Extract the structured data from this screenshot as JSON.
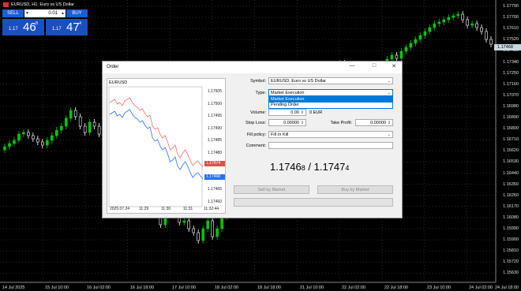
{
  "header": {
    "title": "EURUSD, H1: Euro vs US Dollar",
    "sell_label": "SELL",
    "buy_label": "BUY",
    "volume": "0.01",
    "sell_small": "1.17",
    "sell_big": "46",
    "sell_sup": "8",
    "buy_small": "1.17",
    "buy_big": "47",
    "buy_sup": "4"
  },
  "main_axis": {
    "prices": [
      "1.17790",
      "1.17700",
      "1.17610",
      "1.17520",
      "1.17430",
      "1.17340",
      "1.17250",
      "1.17160",
      "1.17070",
      "1.16980",
      "1.16890",
      "1.16800",
      "1.16710",
      "1.16620",
      "1.16530",
      "1.16440",
      "1.16350",
      "1.16260",
      "1.16170",
      "1.16080",
      "1.15990",
      "1.15900",
      "1.15810",
      "1.15720",
      "1.15630"
    ],
    "current_price": "1.17468",
    "dates": [
      "14 Jul 2025",
      "15 Jul 10:00",
      "16 Jul 02:00",
      "16 Jul 18:00",
      "17 Jul 10:00",
      "18 Jul 02:00",
      "18 Jul 18:00",
      "21 Jul 10:00",
      "22 Jul 02:00",
      "22 Jul 18:00",
      "23 Jul 10:00",
      "24 Jul 02:00",
      "24 Jul 18:00"
    ]
  },
  "dialog": {
    "title": "Order",
    "mini_chart": {
      "symbol": "EURUSD",
      "prices": [
        "1.17505",
        "1.17500",
        "1.17495",
        "1.17490",
        "1.17485",
        "1.17480",
        "1.17475",
        "1.17470",
        "1.17465",
        "1.17460"
      ],
      "ask_tag": "1.17474",
      "bid_tag": "1.17468",
      "dates": [
        "2025.07.24",
        "11:29",
        "11:30",
        "11:31",
        "11:32:44"
      ]
    },
    "symbol_label": "Symbol:",
    "symbol_value": "EURUSD, Euro vs US Dollar",
    "type_label": "Type:",
    "type_value": "Market Execution",
    "type_options": [
      "Market Execution",
      "Pending Order"
    ],
    "volume_label": "Volume:",
    "volume_value": "0.00",
    "volume_unit": "0 EUR",
    "stop_loss_label": "Stop Loss:",
    "stop_loss_value": "0.00000",
    "take_profit_label": "Take Profit:",
    "take_profit_value": "0.00000",
    "fill_policy_label": "Fill policy:",
    "fill_policy_value": "Fill or Kill",
    "comment_label": "Comment:",
    "comment_value": "",
    "quote_bid_main": "1.1746",
    "quote_bid_small": "8",
    "quote_sep": " / ",
    "quote_ask_main": "1.1747",
    "quote_ask_small": "4",
    "sell_button": "Sell by Market",
    "buy_button": "Buy by Market"
  },
  "colors": {
    "bull": "#00c800",
    "bear": "#ffffff",
    "bid_line": "#2a6fff",
    "ask_line": "#ff6a6a",
    "accent": "#1a5dd6"
  }
}
